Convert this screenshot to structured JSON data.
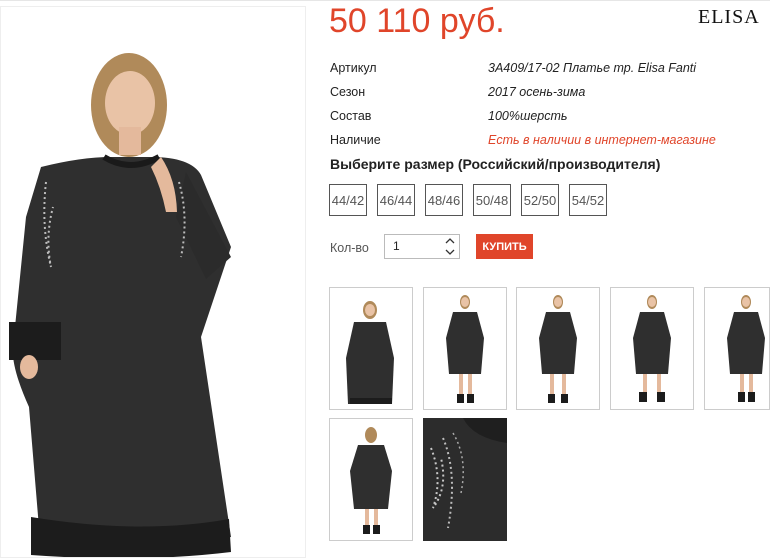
{
  "product": {
    "price": "50 110 руб.",
    "brand": "ELISA"
  },
  "props": [
    {
      "key": "Артикул",
      "value": "3A409/17-02 Платье тр. Elisa Fanti"
    },
    {
      "key": "Сезон",
      "value": "2017 осень-зима"
    },
    {
      "key": "Состав",
      "value": "100%шерсть"
    },
    {
      "key": "Наличие",
      "value": "Есть в наличии в интернет-магазине"
    }
  ],
  "sizes": {
    "title": "Выберите размер (Российский/производителя)",
    "options": [
      "44/42",
      "46/44",
      "48/46",
      "50/48",
      "52/50",
      "54/52"
    ]
  },
  "order": {
    "qty_label": "Кол-во",
    "qty_value": "1",
    "buy_label": "КУПИТЬ"
  },
  "colors": {
    "accent": "#e0452a",
    "dress": "#2f2f2f"
  }
}
